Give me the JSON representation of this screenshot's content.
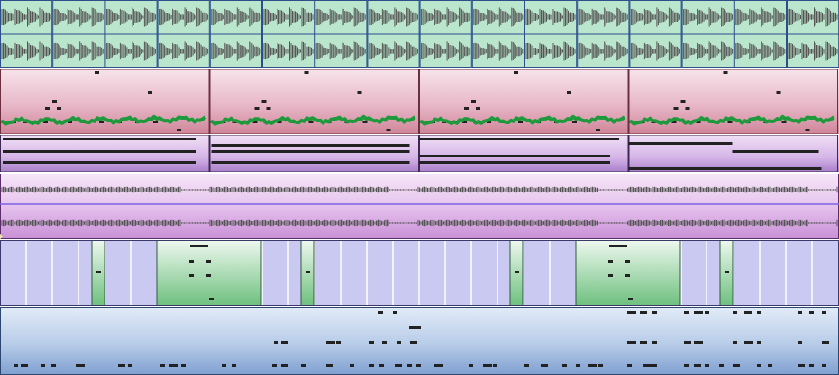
{
  "tracks": [
    {
      "id": "sample-audio",
      "kind": "audio-clips",
      "clips": 16
    },
    {
      "id": "drum-pattern",
      "kind": "note-pattern-with-automation",
      "clips": 4
    },
    {
      "id": "pad-notes",
      "kind": "long-note-lanes",
      "clips": 4
    },
    {
      "id": "audio-recording",
      "kind": "audio-waveform",
      "clips": 1
    },
    {
      "id": "chord-pattern",
      "kind": "pattern-blocks",
      "clips": 8
    },
    {
      "id": "melody-notes",
      "kind": "note-sequence",
      "clips": 1
    }
  ],
  "colors": {
    "audio_clip_fill": "#b9e6cd",
    "audio_clip_border": "#2c4f8a",
    "automation_line": "#1e9a3c",
    "note": "#222222",
    "waveform": "#555555",
    "pattern_block_green": "#8fd49e",
    "playhead_marker": "#efe6b0"
  },
  "icons": [
    "playhead-marker-icon"
  ]
}
